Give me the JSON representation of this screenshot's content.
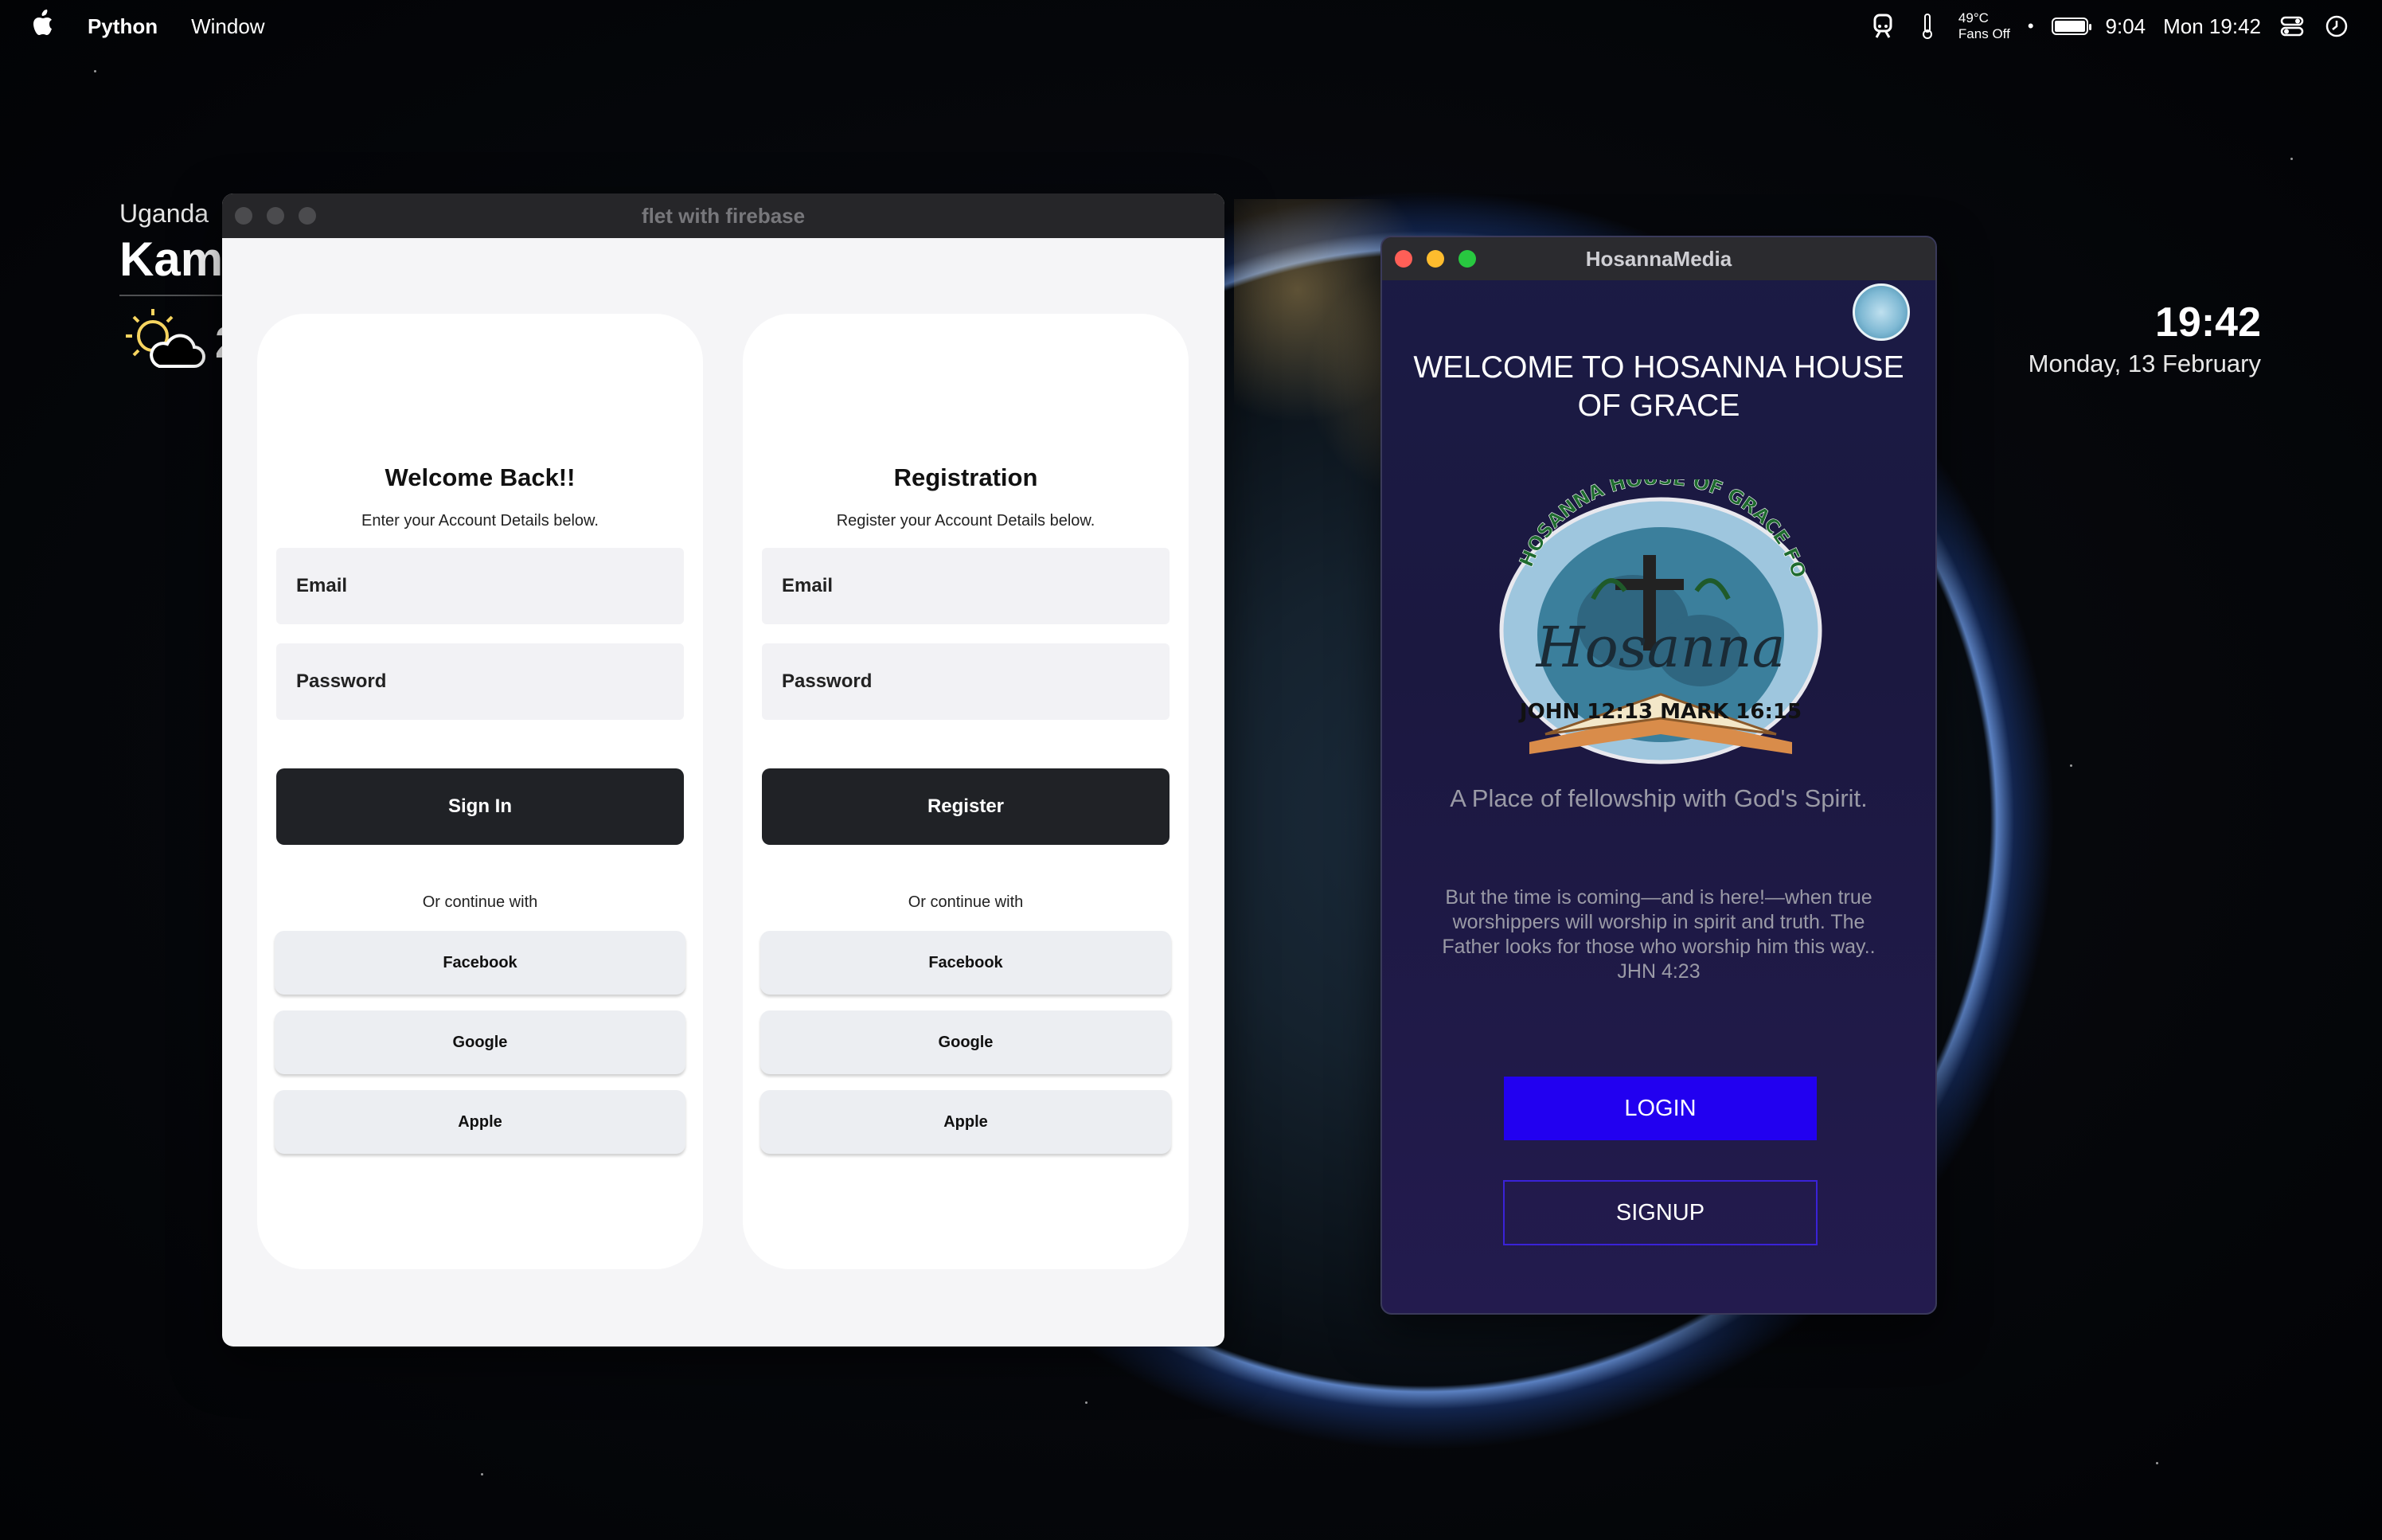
{
  "menubar": {
    "app_name": "Python",
    "menu_window": "Window",
    "temperature": "49°C",
    "fans": "Fans Off",
    "dot": "•",
    "time_short": "9:04",
    "datetime": "Mon 19:42"
  },
  "weather_widget": {
    "country": "Uganda",
    "city": "Kamp",
    "temp": "2"
  },
  "clock_widget": {
    "time": "19:42",
    "date": "Monday, 13 February"
  },
  "login_window": {
    "title": "flet with firebase",
    "signin_card": {
      "heading": "Welcome Back!!",
      "subtitle": "Enter your Account Details below.",
      "email_placeholder": "Email",
      "password_placeholder": "Password",
      "primary_label": "Sign In",
      "or_text": "Or continue with",
      "social": [
        "Facebook",
        "Google",
        "Apple"
      ]
    },
    "register_card": {
      "heading": "Registration",
      "subtitle": "Register your Account Details below.",
      "email_placeholder": "Email",
      "password_placeholder": "Password",
      "primary_label": "Register",
      "or_text": "Or continue with",
      "social": [
        "Facebook",
        "Google",
        "Apple"
      ]
    }
  },
  "hosanna_window": {
    "title": "HosannaMedia",
    "welcome": "WELCOME TO HOSANNA HOUSE OF GRACE",
    "logo_arc_text": "HOSANNA HOUSE OF GRACE FOR ALL NATIONS",
    "logo_script_text": "Hosanna",
    "logo_book_text": "JOHN 12:13 MARK 16:15",
    "tagline": "A Place of fellowship with God's Spirit.",
    "verse": "But the time is coming—and is here!—when true worshippers will worship in spirit and truth. The Father looks for those who worship him this way.. JHN 4:23",
    "login_label": "LOGIN",
    "signup_label": "SIGNUP"
  },
  "colors": {
    "login_button": "#2200f0",
    "primary_dark": "#202226",
    "hosanna_bg": "#1b1b45"
  }
}
